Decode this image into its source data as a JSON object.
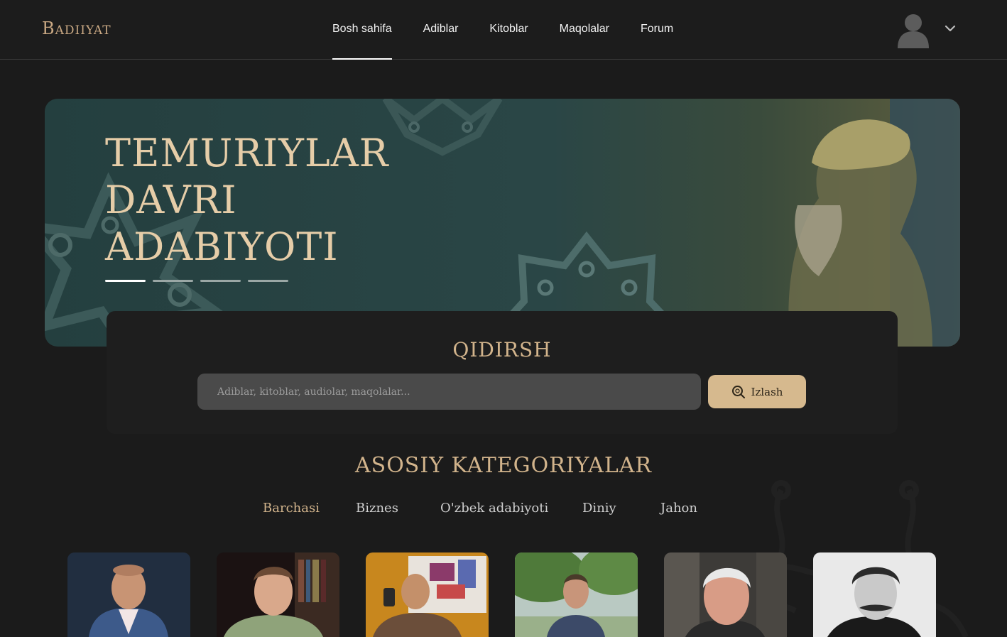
{
  "header": {
    "logo": "Badiiyat",
    "nav": [
      {
        "label": "Bosh sahifa",
        "active": true
      },
      {
        "label": "Adiblar",
        "active": false
      },
      {
        "label": "Kitoblar",
        "active": false
      },
      {
        "label": "Maqolalar",
        "active": false
      },
      {
        "label": "Forum",
        "active": false
      }
    ],
    "avatar_icon": "user-avatar-icon",
    "dropdown_icon": "chevron-down-icon"
  },
  "hero": {
    "title": "Temuriylar davri adabiyoti",
    "slide_count": 4,
    "active_slide": 1
  },
  "search": {
    "title": "Qidirsh",
    "placeholder": "Adiblar, kitoblar, audiolar, maqolalar...",
    "button_label": "Izlash",
    "button_icon": "search-icon"
  },
  "categories": {
    "title": "Asosiy kategoriyalar",
    "tabs": [
      {
        "label": "Barchasi",
        "active": true
      },
      {
        "label": "Biznes",
        "active": false
      },
      {
        "label": "O'zbek adabiyoti",
        "active": false
      },
      {
        "label": "Diniy",
        "active": false
      },
      {
        "label": "Jahon",
        "active": false
      }
    ]
  },
  "authors": [
    {
      "photo": "author-photo"
    },
    {
      "photo": "author-photo"
    },
    {
      "photo": "author-photo"
    },
    {
      "photo": "author-photo"
    },
    {
      "photo": "author-photo"
    },
    {
      "photo": "author-photo"
    }
  ],
  "colors": {
    "background": "#1b1b1b",
    "accent": "#d2b48c",
    "hero_bg": "#2a4646",
    "search_button": "#d6b98e"
  }
}
